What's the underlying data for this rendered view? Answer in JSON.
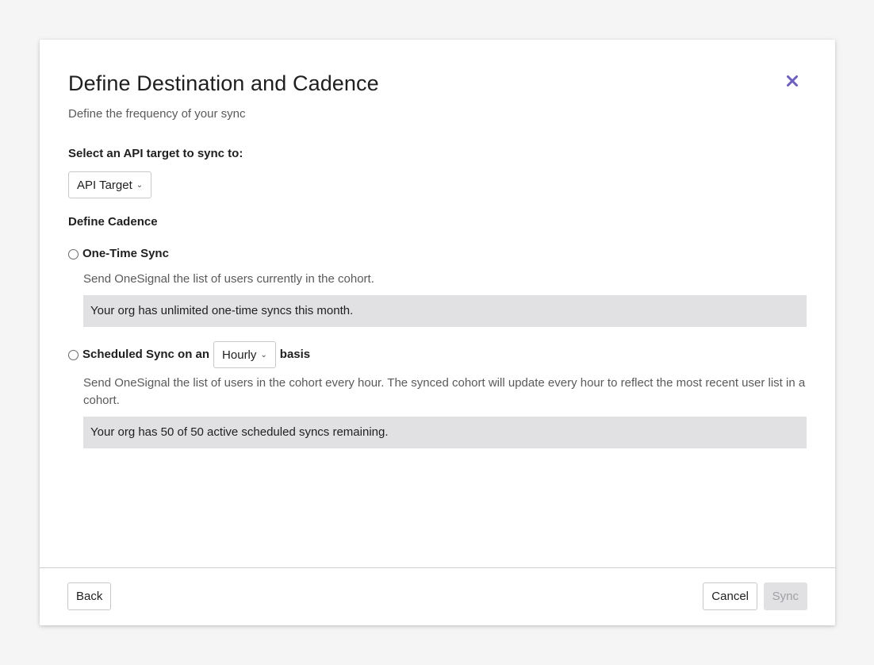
{
  "modal": {
    "title": "Define Destination and Cadence",
    "subtitle": "Define the frequency of your sync",
    "close_icon": "close-icon",
    "accent_color": "#6c5ec4"
  },
  "api_target": {
    "label": "Select an API target to sync to:",
    "selected": "API Target",
    "chevron": "chevron-down-icon"
  },
  "cadence": {
    "label": "Define Cadence",
    "one_time": {
      "label": "One-Time Sync",
      "description": "Send OneSignal the list of users currently in the cohort.",
      "note": "Your org has unlimited one-time syncs this month.",
      "selected": false
    },
    "scheduled": {
      "label_prefix": "Scheduled Sync on an",
      "frequency_selected": "Hourly",
      "label_suffix": "basis",
      "description": "Send OneSignal the list of users in the cohort every hour. The synced cohort will update every hour to reflect the most recent user list in a cohort.",
      "note": "Your org has 50 of 50 active scheduled syncs remaining.",
      "selected": false
    },
    "note_background": "#e1e1e4"
  },
  "footer": {
    "back_label": "Back",
    "cancel_label": "Cancel",
    "sync_label": "Sync",
    "sync_disabled": true
  }
}
